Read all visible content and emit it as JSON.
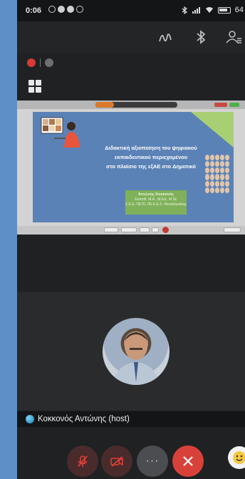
{
  "status_bar": {
    "time": "0:06",
    "battery": "64"
  },
  "slide": {
    "title_line1": "Διδακτική αξιοποίηση του ψηφιακού",
    "title_line2": "εκπαιδευτικού περιεχομένου",
    "title_line3": "στο πλαίσιο της εξΑΕ στο Δημοτικό",
    "author_name": "Αντώνης Κοκκονός",
    "author_line2": "Εκπαιδ. M.A., M.Ed., M.Sc",
    "author_line3": "Σ.Ε.Ε. ΠΕ70, ΠΕ.Κ.Ε.Σ. Θεσσαλονίκης"
  },
  "participant": {
    "name": "Κοκκονός Αντώνης (host)"
  },
  "controls": {
    "more_label": "···"
  },
  "icons": {
    "status_left": [
      "alarm-icon",
      "notification-icon",
      "app-icon",
      "app-icon"
    ],
    "status_right": [
      "bluetooth-icon",
      "signal-icon",
      "wifi-icon",
      "battery-icon"
    ],
    "toolbar": [
      "annotate-icon",
      "bluetooth-icon",
      "participants-icon"
    ],
    "bottom": [
      "mic-off-icon",
      "camera-off-icon",
      "more-icon",
      "end-call-icon",
      "emoji-icon"
    ]
  },
  "colors": {
    "end_call": "#d8413a",
    "muted_indicator": "#d63b34",
    "slide_background": "#5b82b6",
    "slide_author_box": "#7fb15a",
    "page_background": "#5e8fc6"
  }
}
